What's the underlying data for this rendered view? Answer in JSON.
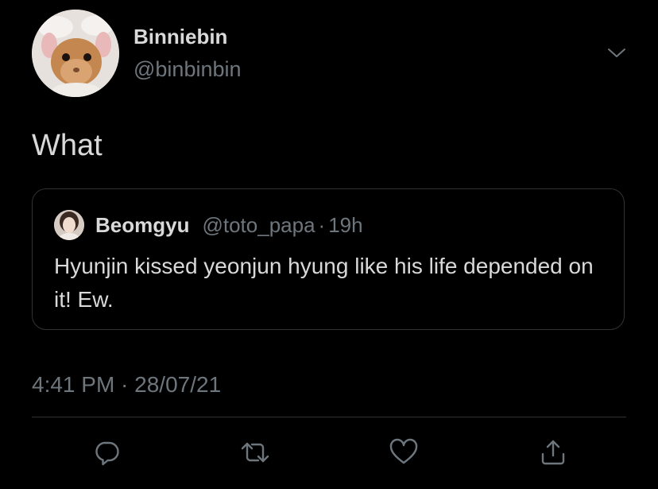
{
  "colors": {
    "background": "#000000",
    "primary_text": "#d9d9d9",
    "secondary_text": "#6e767d",
    "border": "#2f3336"
  },
  "author": {
    "display_name": "Binniebin",
    "handle": "@binbinbin",
    "avatar_icon": "bunny-in-sheep-hat-avatar"
  },
  "tweet": {
    "text": "What",
    "timestamp": "4:41 PM · 28/07/21"
  },
  "quoted_tweet": {
    "display_name": "Beomgyu",
    "handle": "@toto_papa",
    "separator": "·",
    "age": "19h",
    "text": "Hyunjin kissed yeonjun hyung like his life depended on it! Ew.",
    "avatar_icon": "person-avatar"
  },
  "icons": {
    "menu": "chevron-down-icon",
    "reply": "reply-icon",
    "retweet": "retweet-icon",
    "like": "heart-icon",
    "share": "share-icon"
  }
}
